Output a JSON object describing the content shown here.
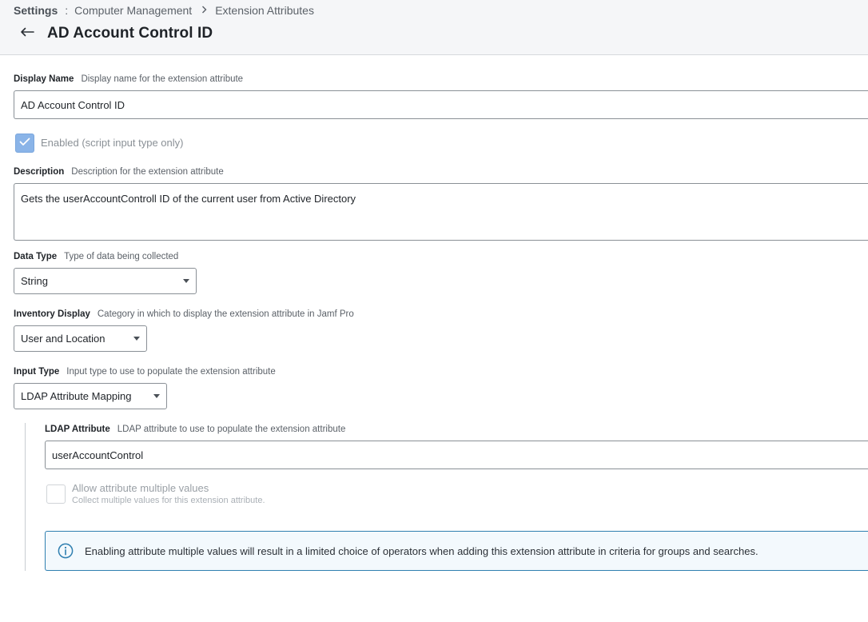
{
  "breadcrumb": {
    "root": "Settings",
    "separator": ":",
    "section": "Computer Management",
    "page": "Extension Attributes"
  },
  "header": {
    "title": "AD Account Control ID"
  },
  "display_name": {
    "label": "Display Name",
    "hint": "Display name for the extension attribute",
    "value": "AD Account Control ID"
  },
  "enabled": {
    "label": "Enabled (script input type only)",
    "checked": true
  },
  "description": {
    "label": "Description",
    "hint": "Description for the extension attribute",
    "value": "Gets the userAccountControll ID of the current user from Active Directory"
  },
  "data_type": {
    "label": "Data Type",
    "hint": "Type of data being collected",
    "selected": "String"
  },
  "inventory_display": {
    "label": "Inventory Display",
    "hint": "Category in which to display the extension attribute in Jamf Pro",
    "selected": "User and Location"
  },
  "input_type": {
    "label": "Input Type",
    "hint": "Input type to use to populate the extension attribute",
    "selected": "LDAP Attribute Mapping"
  },
  "ldap_attribute": {
    "label": "LDAP Attribute",
    "hint": "LDAP attribute to use to populate the extension attribute",
    "value": "userAccountControl"
  },
  "multiple_values": {
    "label": "Allow attribute multiple values",
    "hint": "Collect multiple values for this extension attribute.",
    "checked": false
  },
  "info": {
    "text": "Enabling attribute multiple values will result in a limited choice of operators when adding this extension attribute in criteria for groups and searches."
  },
  "colors": {
    "accent": "#2f7fb0",
    "checkbox_checked": "#8ab4e8",
    "header_bg": "#f5f6f8"
  },
  "icons": {
    "back": "arrow-left-icon",
    "check": "checkmark-icon",
    "info": "info-circle-icon",
    "caret": "caret-down-icon",
    "chevron": "chevron-right-icon"
  }
}
